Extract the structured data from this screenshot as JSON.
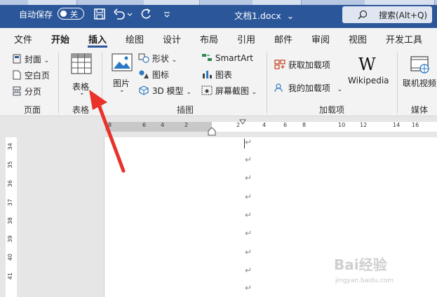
{
  "titlebar": {
    "autosave_label": "自动保存",
    "autosave_state": "关",
    "doc_title": "文档1.docx",
    "doc_title_chevron": "⌄",
    "search_label": "搜索(Alt+Q)"
  },
  "tabs": [
    "文件",
    "开始",
    "插入",
    "绘图",
    "设计",
    "布局",
    "引用",
    "邮件",
    "审阅",
    "视图",
    "开发工具"
  ],
  "active_tab": "插入",
  "ribbon": {
    "pages_group": {
      "cover": "封面",
      "blank": "空白页",
      "break": "分页",
      "label": "页面"
    },
    "table_group": {
      "table": "表格",
      "label": "表格"
    },
    "illus_group": {
      "picture": "图片",
      "shapes": "形状",
      "icons": "图标",
      "model3d": "3D 模型",
      "smartart": "SmartArt",
      "chart": "图表",
      "screenshot": "屏幕截图",
      "label": "插图"
    },
    "addins_group": {
      "get": "获取加载项",
      "mine": "我的加载项",
      "wikipedia": "Wikipedia",
      "label": "加载项"
    },
    "media_group": {
      "video": "联机视频",
      "label": "媒体"
    }
  },
  "ruler": {
    "top_numbers": [
      "8",
      "6",
      "4",
      "2",
      "2",
      "4",
      "6",
      "8",
      "10",
      "12",
      "14",
      "16"
    ],
    "left_numbers": [
      "34",
      "35",
      "36",
      "37",
      "38",
      "39",
      "40",
      "41"
    ]
  },
  "document": {
    "para_mark": "↵"
  },
  "watermark": {
    "main": "Bai经验",
    "sub": "jingyan.baidu.com"
  },
  "colors": {
    "title_bg": "#2b579a",
    "arrow": "#e8322a"
  }
}
